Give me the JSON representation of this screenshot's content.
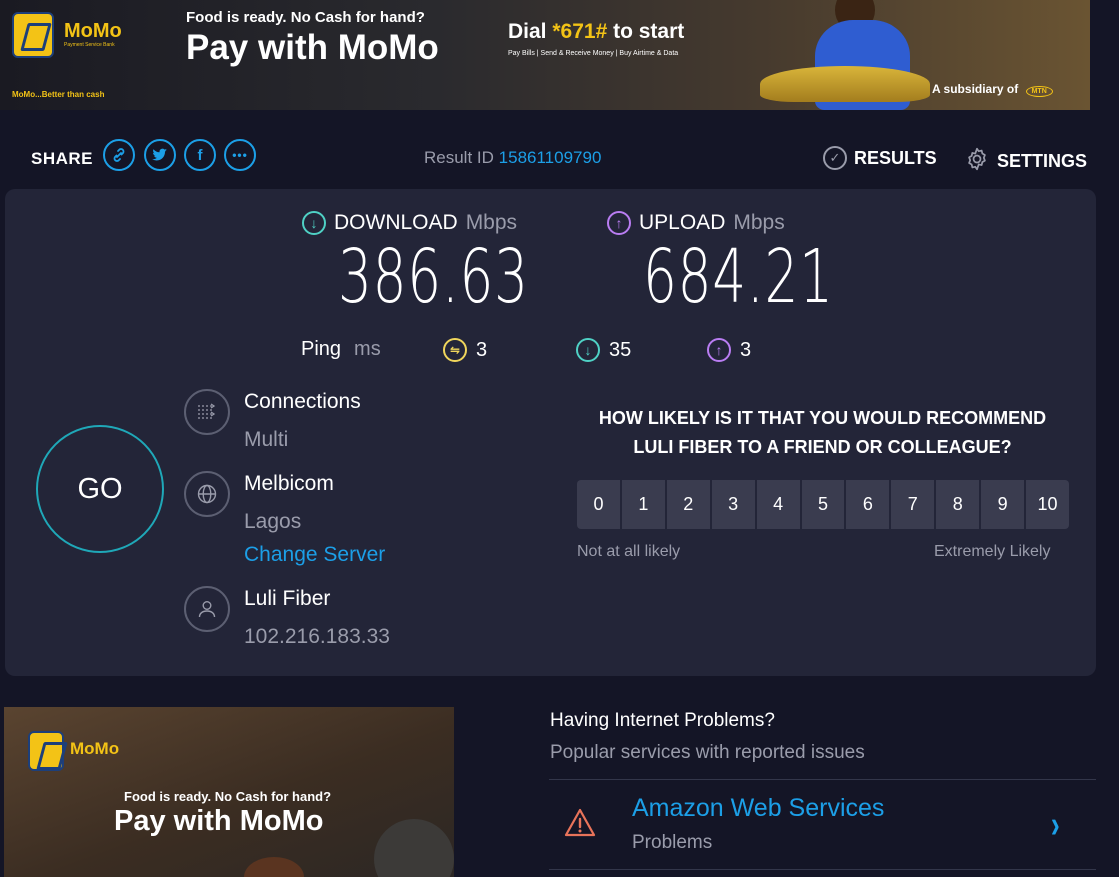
{
  "top_ad": {
    "brand": "MoMo",
    "brand_sub": "Payment Service Bank",
    "tagline_small": "Food is ready. No Cash for hand?",
    "headline": "Pay with MoMo",
    "dial_prefix": "Dial ",
    "dial_code": "*671#",
    "dial_suffix": " to start",
    "services": "Pay Bills | Send & Receive Money | Buy Airtime & Data",
    "slogan": "MoMo...Better than cash",
    "subsidiary": "A subsidiary of",
    "mtn": "MTN"
  },
  "share": {
    "label": "SHARE",
    "icons": [
      "link-icon",
      "twitter-icon",
      "facebook-icon",
      "more-icon"
    ]
  },
  "result": {
    "label": "Result ID",
    "id": "15861109790"
  },
  "nav": {
    "results": "RESULTS",
    "settings": "SETTINGS"
  },
  "download": {
    "label": "DOWNLOAD",
    "unit": "Mbps",
    "value": "386.63",
    "color": "#4fd1c5"
  },
  "upload": {
    "label": "UPLOAD",
    "unit": "Mbps",
    "value": "684.21",
    "color": "#b97df2"
  },
  "ping": {
    "label": "Ping",
    "unit": "ms",
    "idle": "3",
    "download": "35",
    "upload": "3",
    "idle_color": "#f0d65c"
  },
  "go": "GO",
  "connections": {
    "title": "Connections",
    "value": "Multi"
  },
  "server": {
    "name": "Melbicom",
    "location": "Lagos",
    "change": "Change Server"
  },
  "isp": {
    "name": "Luli Fiber",
    "ip": "102.216.183.33"
  },
  "survey": {
    "question_line1": "HOW LIKELY IS IT THAT YOU WOULD RECOMMEND",
    "question_line2": "LULI FIBER TO A FRIEND OR COLLEAGUE?",
    "scale": [
      "0",
      "1",
      "2",
      "3",
      "4",
      "5",
      "6",
      "7",
      "8",
      "9",
      "10"
    ],
    "low_label": "Not at all likely",
    "high_label": "Extremely Likely"
  },
  "bottom_ad": {
    "brand": "MoMo",
    "tagline_small": "Food is ready. No Cash for hand?",
    "headline": "Pay with MoMo"
  },
  "problems": {
    "title": "Having Internet Problems?",
    "subtitle": "Popular services with reported issues",
    "service_name": "Amazon Web Services",
    "service_status": "Problems"
  }
}
